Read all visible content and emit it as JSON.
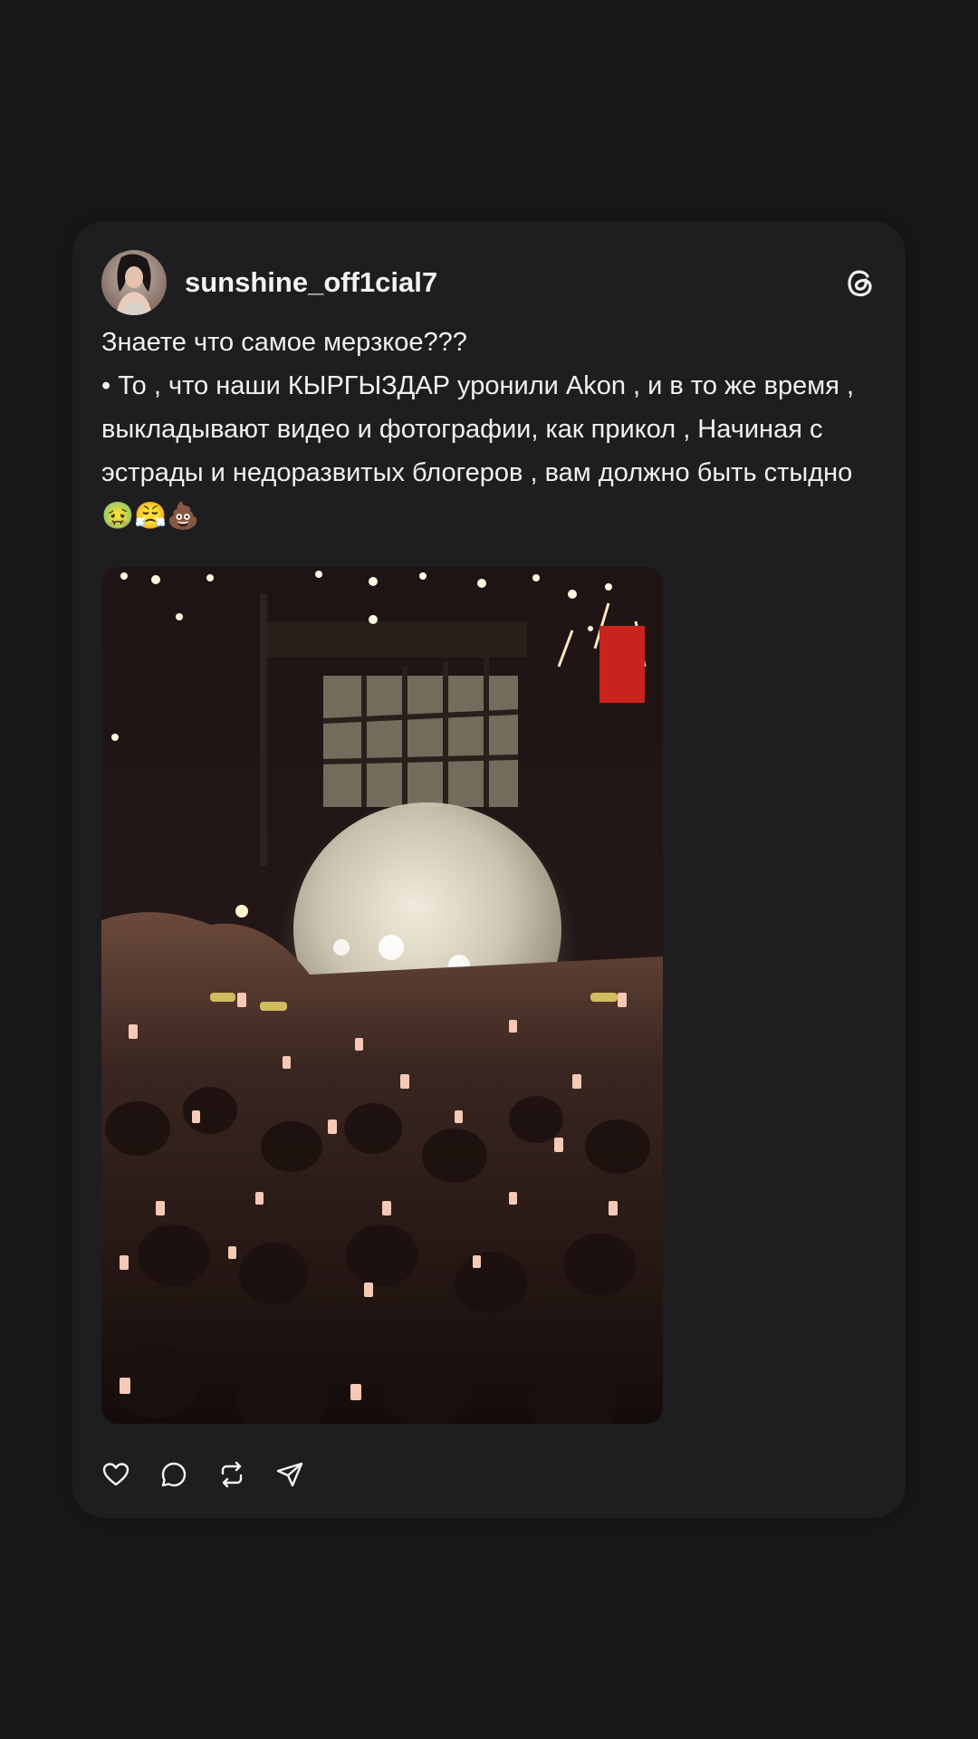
{
  "post": {
    "username": "sunshine_off1cial7",
    "text": "Знаете что самое мерзкое???\n• То , что наши КЫРГЫЗДАР уронили Akon , и в то же время , выкладывают видео и фотографии, как прикол , Начиная с эстрады и недоразвитых блогеров , вам должно быть стыдно 🤢😤💩"
  },
  "icons": {
    "platform": "threads-logo-icon",
    "actions": [
      "heart-icon",
      "comment-icon",
      "repost-icon",
      "send-icon"
    ]
  },
  "colors": {
    "page_background": "#181818",
    "card_background": "#1e1e20",
    "text": "#f1f1f1"
  }
}
